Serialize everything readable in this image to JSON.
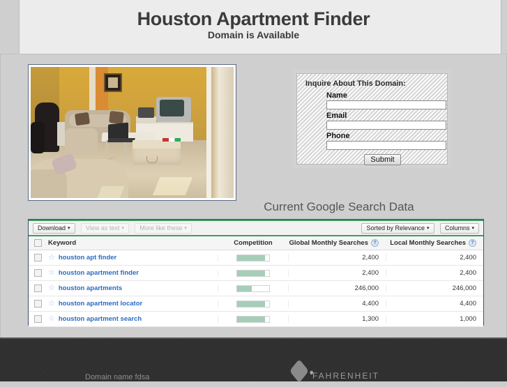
{
  "header": {
    "title": "Houston Apartment Finder",
    "subtitle": "Domain is Available"
  },
  "inquiry_form": {
    "title": "Inquire About This Domain:",
    "fields": [
      {
        "label": "Name",
        "value": "",
        "placeholder": ""
      },
      {
        "label": "Email",
        "value": "",
        "placeholder": ""
      },
      {
        "label": "Phone",
        "value": "",
        "placeholder": ""
      }
    ],
    "submit_label": "Submit"
  },
  "search_section": {
    "heading": "Current Google Search Data"
  },
  "keyword_tool": {
    "toolbar_left": [
      {
        "label": "Download",
        "state": "active"
      },
      {
        "label": "View as text",
        "state": "disabled"
      },
      {
        "label": "More like these",
        "state": "disabled"
      }
    ],
    "toolbar_right": [
      {
        "label": "Sorted by Relevance",
        "state": "active"
      },
      {
        "label": "Columns",
        "state": "active"
      }
    ],
    "caret": "▾",
    "help_glyph": "?",
    "star_glyph": "☆",
    "columns": [
      "Keyword",
      "Competition",
      "Global Monthly Searches",
      "Local Monthly Searches"
    ],
    "rows": [
      {
        "keyword": "houston apt finder",
        "competition": 0.88,
        "global": "2,400",
        "local": "2,400"
      },
      {
        "keyword": "houston apartment finder",
        "competition": 0.88,
        "global": "2,400",
        "local": "2,400"
      },
      {
        "keyword": "houston apartments",
        "competition": 0.45,
        "global": "246,000",
        "local": "246,000"
      },
      {
        "keyword": "houston apartment locator",
        "competition": 0.88,
        "global": "4,400",
        "local": "4,400"
      },
      {
        "keyword": "houston apartment search",
        "competition": 0.88,
        "global": "1,300",
        "local": "1,000"
      }
    ]
  },
  "footer": {
    "text": "Domain name fdsa",
    "brand": "FAHRENHEIT"
  },
  "colors": {
    "accent_green": "#3f9a62",
    "competition_bar": "#a5ceb8",
    "link_blue": "#2a6bc4",
    "panel_border": "#3c4f6b",
    "footer_bg": "#2e2e2e"
  }
}
